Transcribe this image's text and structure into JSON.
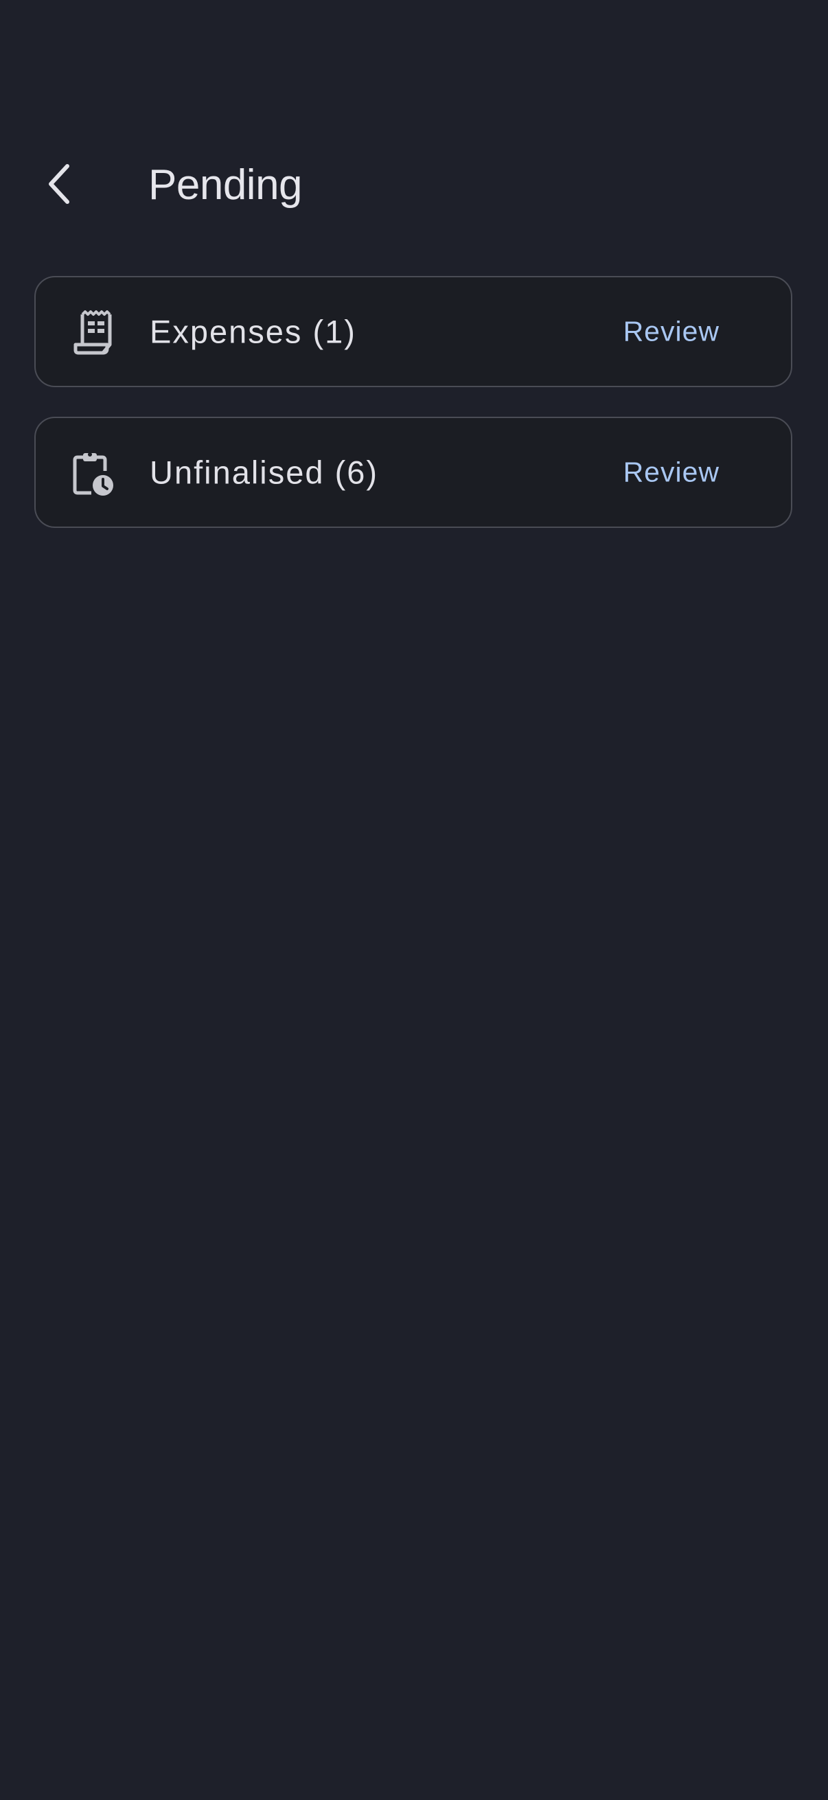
{
  "header": {
    "title": "Pending",
    "back_icon": "chevron-left-icon"
  },
  "items": [
    {
      "icon": "receipt-icon",
      "label": "Expenses (1)",
      "action": "Review"
    },
    {
      "icon": "clipboard-clock-icon",
      "label": "Unfinalised (6)",
      "action": "Review"
    }
  ],
  "colors": {
    "background": "#1e202a",
    "card_background": "#1b1d23",
    "card_border": "#4a4c55",
    "accent": "#a9c7f2",
    "text": "#e4e4ea"
  }
}
